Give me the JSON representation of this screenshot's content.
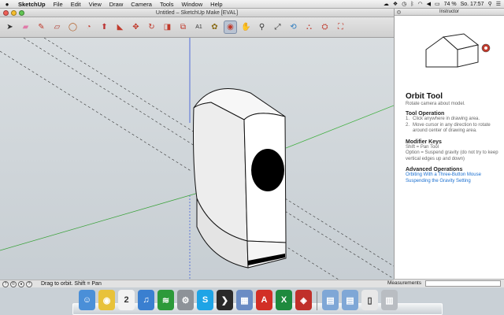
{
  "menubar": {
    "app_name": "SketchUp",
    "items": [
      "File",
      "Edit",
      "View",
      "Draw",
      "Camera",
      "Tools",
      "Window",
      "Help"
    ],
    "battery": "74 %",
    "clock": "So. 17:57"
  },
  "window": {
    "title": "Untitled – SketchUp Make [EVAL]"
  },
  "toolbar": {
    "tools": [
      {
        "name": "select-tool",
        "icon": "arrow-icon",
        "glyph": "➤",
        "color": "#333333"
      },
      {
        "name": "eraser-tool",
        "icon": "eraser-icon",
        "glyph": "▰",
        "color": "#e07aa8"
      },
      {
        "name": "pencil-tool",
        "icon": "pencil-icon",
        "glyph": "✎",
        "color": "#c03a2b"
      },
      {
        "name": "rectangle-tool",
        "icon": "rectangle-icon",
        "glyph": "▱",
        "color": "#b03a2e"
      },
      {
        "name": "circle-tool",
        "icon": "circle-icon",
        "glyph": "◯",
        "color": "#b05a20"
      },
      {
        "name": "arc-tool",
        "icon": "arc-icon",
        "glyph": "◔",
        "color": "#c0392b"
      },
      {
        "name": "push-pull-tool",
        "icon": "push-pull-icon",
        "glyph": "⬆",
        "color": "#b33"
      },
      {
        "name": "follow-me-tool",
        "icon": "follow-me-icon",
        "glyph": "◣",
        "color": "#c0392b"
      },
      {
        "name": "move-tool",
        "icon": "move-icon",
        "glyph": "✥",
        "color": "#c0392b"
      },
      {
        "name": "rotate-tool",
        "icon": "rotate-icon",
        "glyph": "↻",
        "color": "#c0392b"
      },
      {
        "name": "scale-tool",
        "icon": "scale-icon",
        "glyph": "◨",
        "color": "#c0392b"
      },
      {
        "name": "offset-tool",
        "icon": "offset-icon",
        "glyph": "⧉",
        "color": "#c0392b"
      },
      {
        "name": "text-tool",
        "icon": "text-icon",
        "glyph": "A1",
        "color": "#333333"
      },
      {
        "name": "paint-bucket-tool",
        "icon": "paint-bucket-icon",
        "glyph": "✿",
        "color": "#8a6d1a"
      },
      {
        "name": "orbit-tool",
        "icon": "orbit-icon",
        "glyph": "◉",
        "color": "#c0392b"
      },
      {
        "name": "pan-tool",
        "icon": "hand-icon",
        "glyph": "✋",
        "color": "#c68a5a"
      },
      {
        "name": "zoom-tool",
        "icon": "magnifier-icon",
        "glyph": "⚲",
        "color": "#333333"
      },
      {
        "name": "zoom-extents-tool",
        "icon": "zoom-extents-icon",
        "glyph": "⤢",
        "color": "#333333"
      },
      {
        "name": "previous-view-tool",
        "icon": "previous-view-icon",
        "glyph": "⟲",
        "color": "#2a7abf"
      },
      {
        "name": "warehouse-tool",
        "icon": "warehouse-icon",
        "glyph": "⛬",
        "color": "#c0392b"
      },
      {
        "name": "share-model-tool",
        "icon": "share-model-icon",
        "glyph": "⛭",
        "color": "#c0392b"
      },
      {
        "name": "extension-warehouse-tool",
        "icon": "extension-warehouse-icon",
        "glyph": "⛶",
        "color": "#c0392b"
      }
    ],
    "selected_index": 14
  },
  "statusbar": {
    "hint": "Drag to orbit.  Shift = Pan"
  },
  "instructor": {
    "panel_title": "Instructor",
    "tool_name": "Orbit Tool",
    "tool_desc": "Rotate camera about model.",
    "operation_heading": "Tool Operation",
    "operation_steps": [
      {
        "num": "1.",
        "text": "Click anywhere in drawing area."
      },
      {
        "num": "2.",
        "text": "Move cursor in any direction to rotate around center of drawing area."
      }
    ],
    "modifier_heading": "Modifier Keys",
    "modifier_lines": [
      "Shift = Pan Tool",
      "Option = Suspend gravity (do not try to keep vertical edges up and down)"
    ],
    "advanced_heading": "Advanced Operations",
    "advanced_links": [
      "Orbiting With a Three-Button Mouse",
      "Suspending the Gravity Setting"
    ]
  },
  "measurements": {
    "label": "Measurements",
    "value": ""
  },
  "dock": {
    "apps": [
      {
        "name": "finder",
        "icon": "finder-icon",
        "glyph": "☺",
        "bg": "#4a8fd8"
      },
      {
        "name": "chrome",
        "icon": "chrome-icon",
        "glyph": "◉",
        "bg": "#e8c23a"
      },
      {
        "name": "calendar",
        "icon": "calendar-icon",
        "glyph": "2",
        "bg": "#f2f2f2"
      },
      {
        "name": "itunes",
        "icon": "itunes-icon",
        "glyph": "♫",
        "bg": "#3a7fd0"
      },
      {
        "name": "spotify",
        "icon": "spotify-icon",
        "glyph": "≋",
        "bg": "#2d9a3a"
      },
      {
        "name": "system-preferences",
        "icon": "gear-icon",
        "glyph": "⚙",
        "bg": "#8d9298"
      },
      {
        "name": "skype",
        "icon": "skype-icon",
        "glyph": "S",
        "bg": "#1ea4e6"
      },
      {
        "name": "quicksilver",
        "icon": "quicksilver-icon",
        "glyph": "❯",
        "bg": "#2a2a2a"
      },
      {
        "name": "preview",
        "icon": "preview-icon",
        "glyph": "▦",
        "bg": "#6a8cc4"
      },
      {
        "name": "acrobat",
        "icon": "acrobat-icon",
        "glyph": "A",
        "bg": "#d22f26"
      },
      {
        "name": "excel",
        "icon": "excel-icon",
        "glyph": "X",
        "bg": "#1e8a3e"
      },
      {
        "name": "sketchup",
        "icon": "sketchup-icon",
        "glyph": "◈",
        "bg": "#c0302a"
      }
    ],
    "folders": [
      {
        "name": "applications-folder",
        "icon": "folder-icon",
        "glyph": "▤",
        "bg": "#7fa7d6"
      },
      {
        "name": "documents-folder",
        "icon": "folder-icon",
        "glyph": "▤",
        "bg": "#7fa7d6"
      },
      {
        "name": "document-stack",
        "icon": "document-icon",
        "glyph": "▯",
        "bg": "#e8e8e8"
      },
      {
        "name": "trash",
        "icon": "trash-icon",
        "glyph": "▥",
        "bg": "#b9bdc2"
      }
    ]
  },
  "colors": {
    "axis_red": "#3aa23a",
    "axis_green": "#43b043",
    "axis_blue": "#3050d8"
  }
}
